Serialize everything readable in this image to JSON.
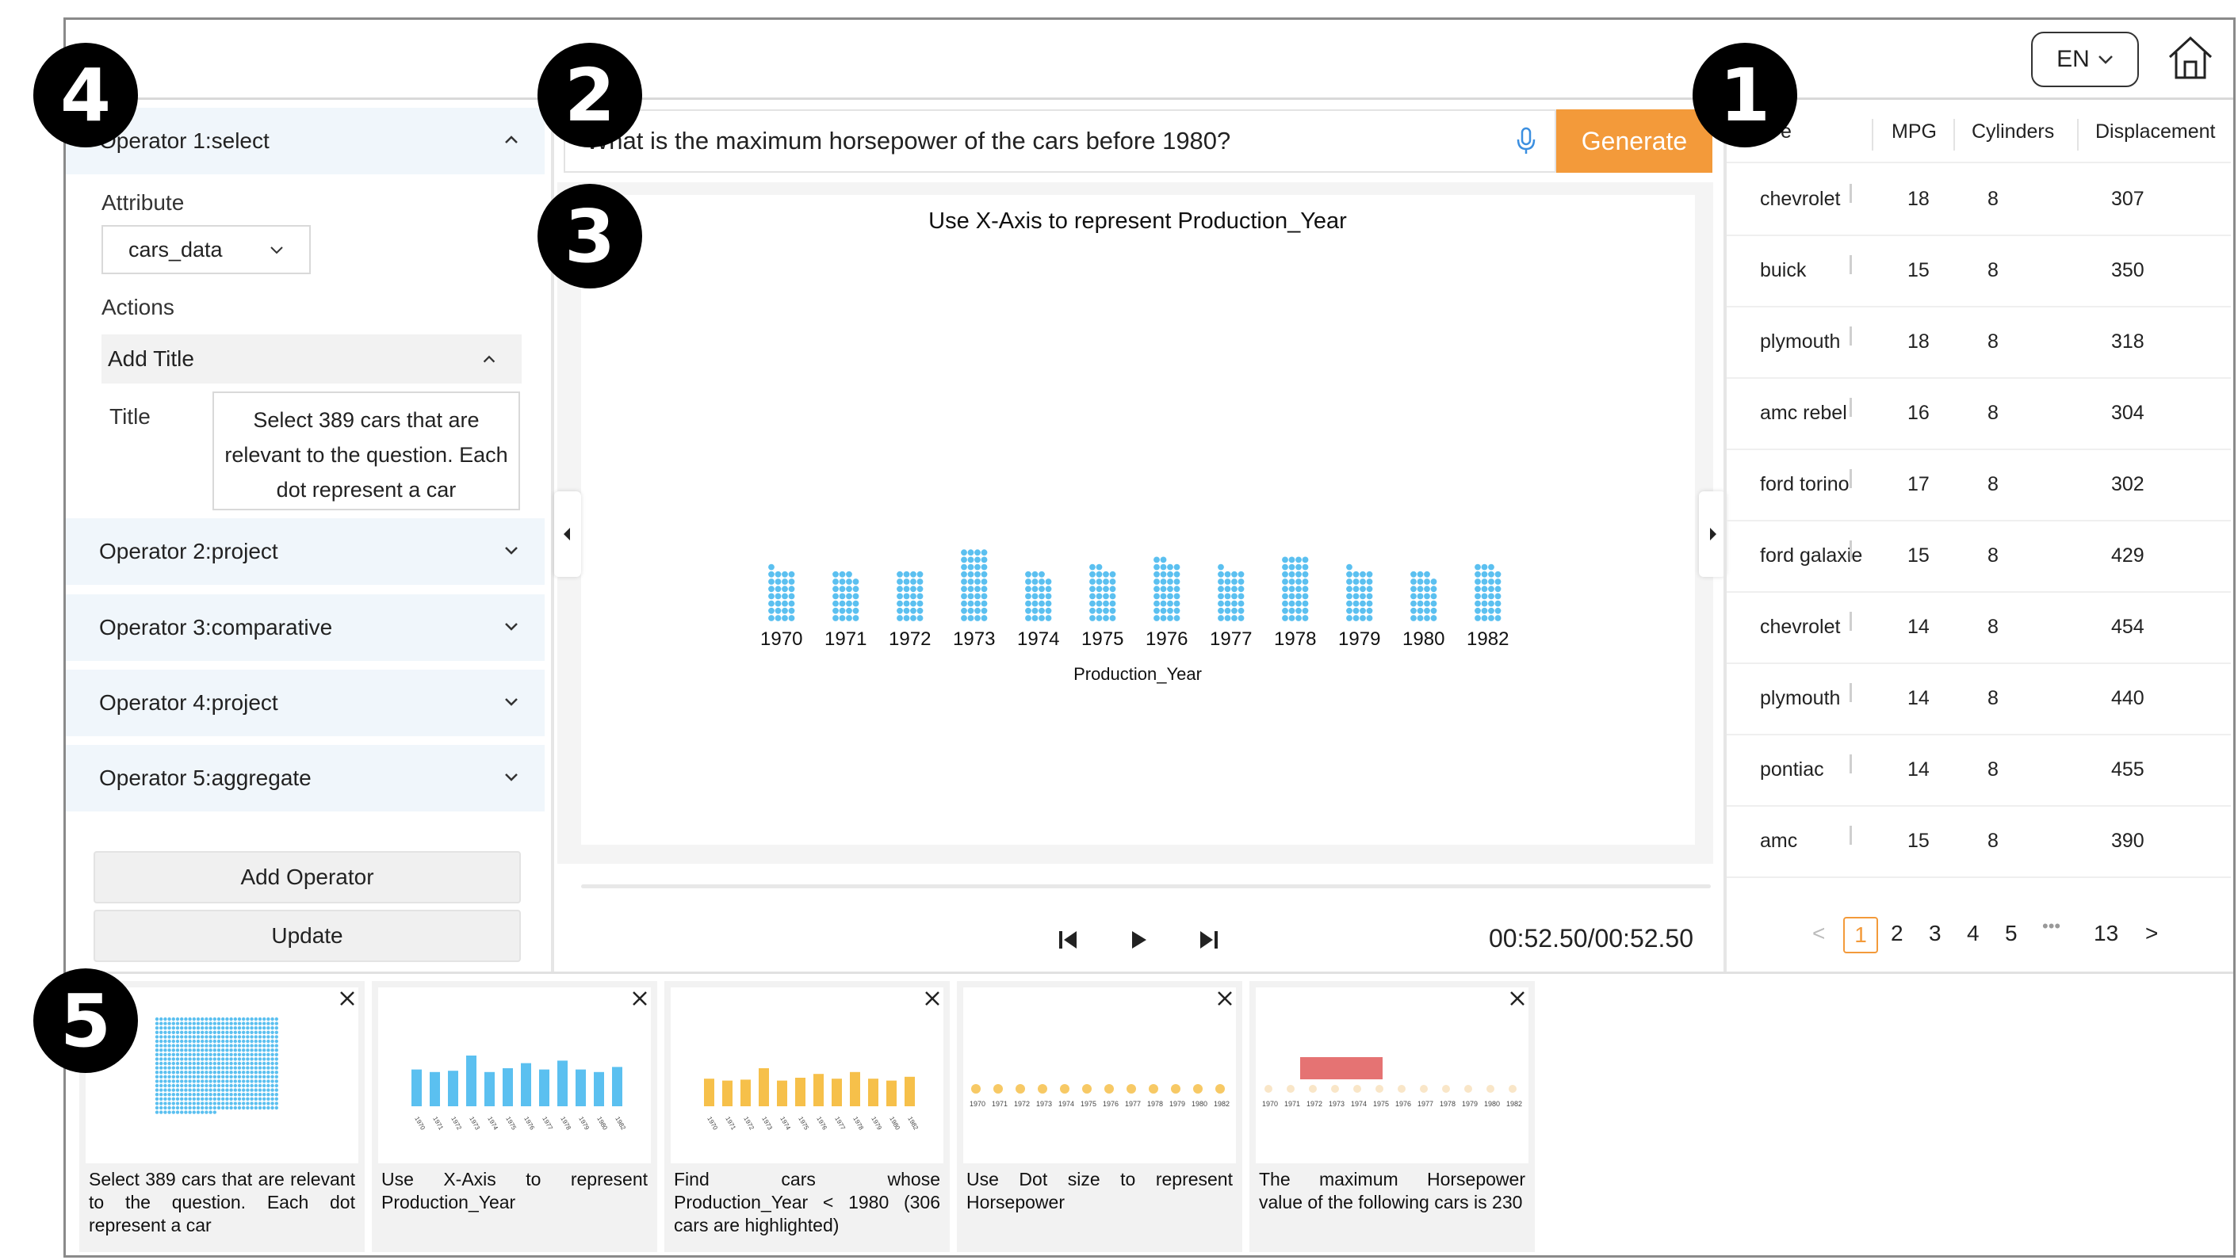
{
  "header": {
    "language": "EN"
  },
  "badges": [
    "1",
    "2",
    "3",
    "4",
    "5"
  ],
  "left_panel": {
    "operator1": {
      "label": "Operator 1:select",
      "attribute_label": "Attribute",
      "attribute_value": "cars_data",
      "actions_label": "Actions",
      "action_name": "Add Title",
      "title_label": "Title",
      "title_value": "Select 389 cars that are relevant to the question. Each dot represent a car"
    },
    "operators": [
      "Operator 2:project",
      "Operator 3:comparative",
      "Operator 4:project",
      "Operator 5:aggregate"
    ],
    "add_operator_label": "Add Operator",
    "update_label": "Update"
  },
  "query": {
    "text": "What is the maximum horsepower of the cars before 1980?",
    "generate_label": "Generate"
  },
  "chart_data": {
    "type": "bar",
    "title": "Use X-Axis to represent Production_Year",
    "xlabel": "Production_Year",
    "ylabel": "",
    "categories": [
      "1970",
      "1971",
      "1972",
      "1973",
      "1974",
      "1975",
      "1976",
      "1977",
      "1978",
      "1979",
      "1980",
      "1982"
    ],
    "values": [
      29,
      27,
      28,
      40,
      27,
      30,
      34,
      29,
      36,
      29,
      27,
      31
    ],
    "encoding": "each dot represents a car"
  },
  "player": {
    "time": "00:52.50/00:52.50"
  },
  "table": {
    "columns": [
      "e",
      "MPG",
      "Cylinders",
      "Displacement"
    ],
    "rows": [
      [
        "chevrolet",
        "18",
        "8",
        "307"
      ],
      [
        "buick",
        "15",
        "8",
        "350"
      ],
      [
        "plymouth",
        "18",
        "8",
        "318"
      ],
      [
        "amc rebel",
        "16",
        "8",
        "304"
      ],
      [
        "ford torino",
        "17",
        "8",
        "302"
      ],
      [
        "ford galaxie",
        "15",
        "8",
        "429"
      ],
      [
        "chevrolet",
        "14",
        "8",
        "454"
      ],
      [
        "plymouth",
        "14",
        "8",
        "440"
      ],
      [
        "pontiac",
        "14",
        "8",
        "455"
      ],
      [
        "amc",
        "15",
        "8",
        "390"
      ]
    ],
    "pagination": {
      "current": "1",
      "pages": [
        "2",
        "3",
        "4",
        "5"
      ],
      "ellipsis": "•••",
      "last": "13"
    }
  },
  "cards": [
    {
      "caption": "Select 389 cars that are relevant to the question. Each dot represent a car"
    },
    {
      "caption": "Use X-Axis to represent Production_Year"
    },
    {
      "caption": "Find cars whose Production_Year < 1980 (306 cars are highlighted)"
    },
    {
      "caption": "Use Dot size to represent Horsepower"
    },
    {
      "caption": "The maximum Horsepower value of the following cars is 230"
    }
  ],
  "colors": {
    "accent": "#f39a3a",
    "dot_blue": "#5bc0f0",
    "dot_orange": "#f6c04a",
    "highlight_red": "#e57373"
  }
}
